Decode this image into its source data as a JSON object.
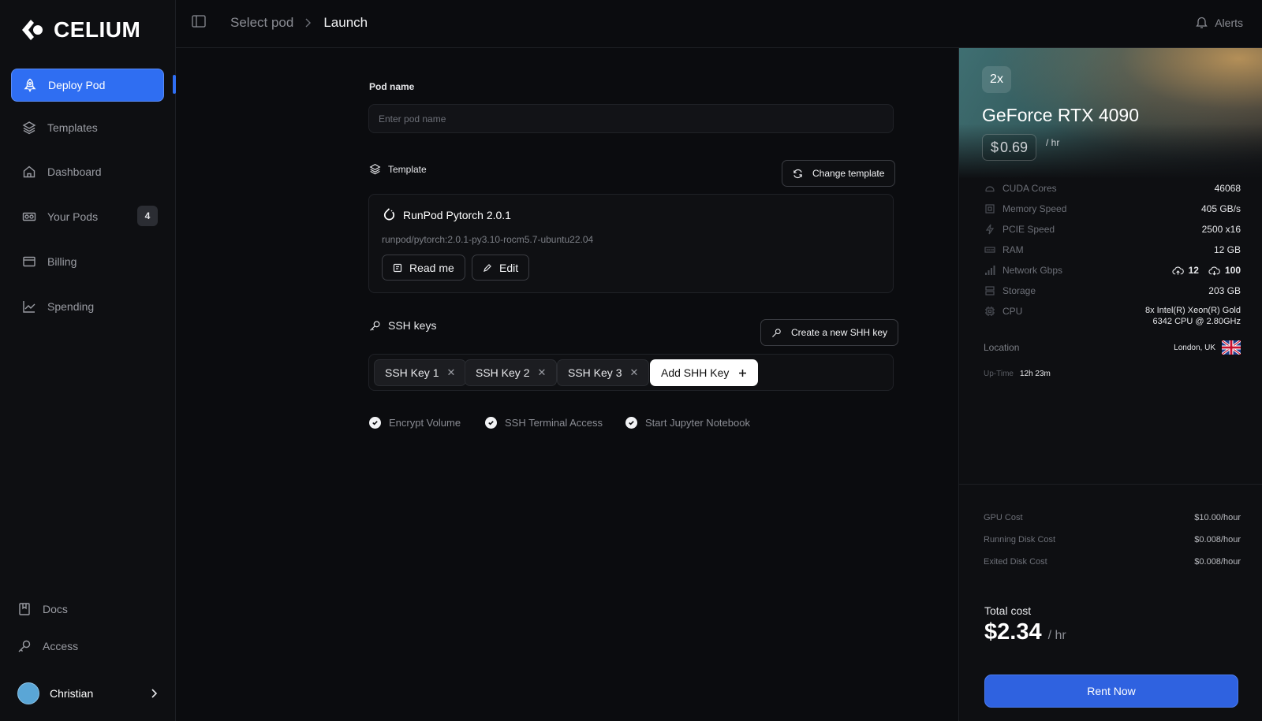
{
  "brand": {
    "name": "CELIUM"
  },
  "sidebar": {
    "items": [
      {
        "label": "Deploy Pod",
        "icon": "rocket-icon"
      },
      {
        "label": "Templates",
        "icon": "layers-icon"
      },
      {
        "label": "Dashboard",
        "icon": "home-icon"
      },
      {
        "label": "Your Pods",
        "icon": "gpu-icon",
        "badge": "4"
      },
      {
        "label": "Billing",
        "icon": "wallet-icon"
      },
      {
        "label": "Spending",
        "icon": "chart-line-icon"
      }
    ],
    "footer": [
      {
        "label": "Docs",
        "icon": "book-icon"
      },
      {
        "label": "Access",
        "icon": "key-icon"
      }
    ],
    "user": {
      "name": "Christian"
    }
  },
  "topbar": {
    "breadcrumb": [
      "Select pod",
      "Launch"
    ],
    "alerts_label": "Alerts"
  },
  "form": {
    "pod_name_label": "Pod name",
    "pod_name_placeholder": "Enter pod name",
    "template_label": "Template",
    "change_template_label": "Change template",
    "template": {
      "name": "RunPod Pytorch 2.0.1",
      "path": "runpod/pytorch:2.0.1-py3.10-rocm5.7-ubuntu22.04",
      "readme_label": "Read me",
      "edit_label": "Edit"
    },
    "ssh_label": "SSH keys",
    "create_ssh_label": "Create a new SHH key",
    "ssh_keys": [
      "SSH Key 1",
      "SSH Key 2",
      "SSH Key 3"
    ],
    "add_ssh_label": "Add SHH Key",
    "options": [
      {
        "label": "Encrypt Volume",
        "checked": true
      },
      {
        "label": "SSH Terminal Access",
        "checked": true
      },
      {
        "label": "Start Jupyter Notebook",
        "checked": true
      }
    ]
  },
  "gpu": {
    "count": "2x",
    "name": "GeForce RTX 4090",
    "price_symbol": "$",
    "price": "0.69",
    "price_unit": "/ hr",
    "specs": [
      {
        "label": "CUDA Cores",
        "value": "46068"
      },
      {
        "label": "Memory Speed",
        "value": "405 GB/s"
      },
      {
        "label": "PCIE Speed",
        "value": "2500  x16"
      },
      {
        "label": "RAM",
        "value": "12 GB"
      },
      {
        "label": "Network Gbps",
        "upload": "12",
        "download": "100"
      },
      {
        "label": "Storage",
        "value": "203 GB"
      },
      {
        "label": "CPU",
        "value_line1": "8x Intel(R) Xeon(R) Gold",
        "value_line2": "6342 CPU @ 2.80GHz"
      }
    ],
    "location_label": "Location",
    "location_value": "London, UK",
    "uptime_label": "Up-Time",
    "uptime_value": "12h 23m"
  },
  "costs": {
    "rows": [
      {
        "label": "GPU Cost",
        "value": "$10.00/hour"
      },
      {
        "label": "Running Disk Cost",
        "value": "$0.008/hour"
      },
      {
        "label": "Exited Disk Cost",
        "value": "$0.008/hour"
      }
    ],
    "total_label": "Total cost",
    "total_value": "$2.34",
    "total_unit": "/ hr",
    "rent_label": "Rent Now"
  },
  "colors": {
    "accent": "#2f6ef2",
    "background": "#0b0c0f",
    "panel": "#0e0f12"
  }
}
